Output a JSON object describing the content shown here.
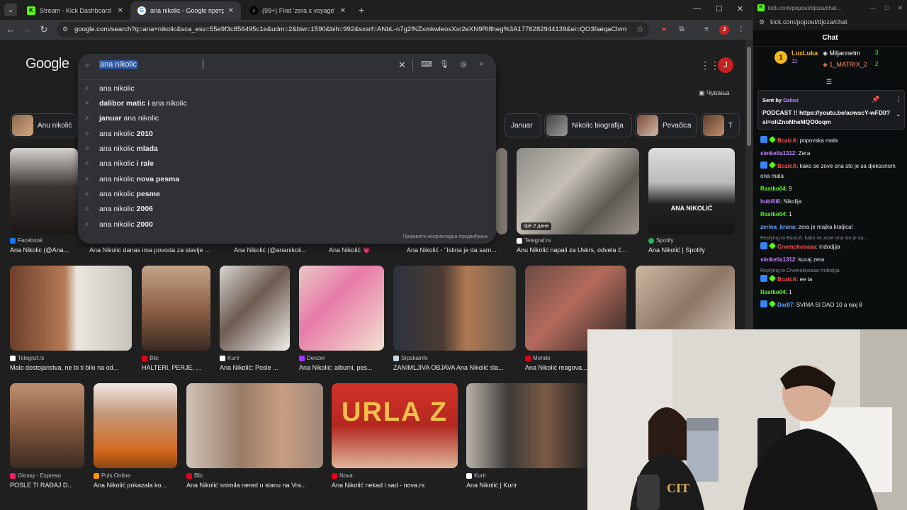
{
  "browser": {
    "tabs": [
      {
        "title": "Stream - Kick Dashboard",
        "favicon": "kick-icon",
        "active": false
      },
      {
        "title": "ana nikolic - Google претрага",
        "favicon": "google-icon",
        "active": true
      },
      {
        "title": "(99+) Find 'zera x voyage' on Ti...",
        "favicon": "tiktok-icon",
        "active": false
      }
    ],
    "url": "google.com/search?q=ana+nikolic&sca_esv=55e9f3c856495c1e&udm=2&biw=1590&bih=992&sxsrf=ANbL-n7g2fNZxmkwleosXxr2eXN9Rl8heg%3A1776282944139&ei=QO3faeqaClvmxc8...",
    "profile_initial": "J"
  },
  "google": {
    "logo": "Google",
    "avatar_initial": "J",
    "save_label": "Чувања",
    "query": "ana nikolic",
    "suggestions": [
      {
        "prefix": "",
        "bold": "",
        "suffix": "ana nikolic"
      },
      {
        "prefix": "",
        "bold": "dalibor matic i",
        "suffix": " ana nikolic"
      },
      {
        "prefix": "",
        "bold": "januar",
        "suffix": " ana nikolic"
      },
      {
        "prefix": "ana nikolic ",
        "bold": "2010",
        "suffix": ""
      },
      {
        "prefix": "ana nikolic ",
        "bold": "mlada",
        "suffix": ""
      },
      {
        "prefix": "ana nikolic ",
        "bold": "i rale",
        "suffix": ""
      },
      {
        "prefix": "ana nikolic ",
        "bold": "nova pesma",
        "suffix": ""
      },
      {
        "prefix": "ana nikolic ",
        "bold": "pesme",
        "suffix": ""
      },
      {
        "prefix": "ana nikolic ",
        "bold": "2006",
        "suffix": ""
      },
      {
        "prefix": "ana nikolic ",
        "bold": "2000",
        "suffix": ""
      }
    ],
    "report_text": "Пријавите неприкладна предвиђања",
    "chips": [
      "Anu nikolić",
      "Januar",
      "Nikolic biografija",
      "Pevačica",
      "T"
    ],
    "images_row1": [
      {
        "source": "Facebook",
        "caption": "Ana Nikolic (@Ana..."
      },
      {
        "source": "",
        "caption": "Ana Nikolić danas ima povoda za slavlje ..."
      },
      {
        "source": "",
        "caption": "Ana Nikolić (@ananikoli..."
      },
      {
        "source": "",
        "caption": "Ana Nikolić 💗"
      },
      {
        "source": "",
        "caption": "Ana Nikolić - \"Istina je da sam..."
      },
      {
        "source": "Telegraf.rs",
        "caption": "Anu Nikolić napali za Uskrs, odvela č...",
        "badge": "пре 2 дана"
      },
      {
        "source": "Spotify",
        "caption": "Ana Nikolić | Spotify",
        "overlay": "ANA NIKOLIĆ"
      }
    ],
    "images_row2": [
      {
        "source": "Telegraf.rs",
        "caption": "Malo dostojanstva, ne bi ti bilo na od..."
      },
      {
        "source": "Blic",
        "caption": "HALTERI, PERJE, ..."
      },
      {
        "source": "Kurir",
        "caption": "Ana Nikolić: Posle ..."
      },
      {
        "source": "Deezer",
        "caption": "Ana Nikolić: albumi, pes..."
      },
      {
        "source": "Srpskainfo",
        "caption": "ZANIMLJIVA OBJAVA Ana Nikolić sla..."
      },
      {
        "source": "Mondo",
        "caption": "Ana Nikolić reagova..."
      }
    ],
    "images_row3": [
      {
        "source": "Glossy - Espreso",
        "caption": "POSLE TI RAĐAJ D..."
      },
      {
        "source": "Puls Online",
        "caption": "Ana Nikolić pokazala ko..."
      },
      {
        "source": "Blic",
        "caption": "Ana Nikolić snimila nered u stanu na Vra..."
      },
      {
        "source": "Nova",
        "caption": "Ana Nikolić nekad i sad - nova.rs",
        "overlay": "URLA Z"
      },
      {
        "source": "Kurir",
        "caption": "Ana Nikolić | Kurir"
      }
    ]
  },
  "chat": {
    "window_title": "kick.com/popout/djoza/chat...",
    "url": "kick.com/popout/djoza/chat",
    "header": "Chat",
    "leaderboard": {
      "first": {
        "name": "LuxLuka",
        "count": "11"
      },
      "second": {
        "name": "Miljannetm",
        "count": "3"
      },
      "third": {
        "name": "1_MATRIX_2",
        "count": "2"
      },
      "rank": "1"
    },
    "pinned": {
      "sent_by_label": "Sent by",
      "user": "Dziksi",
      "body": "PODCAST !! https://youtu.be/aowscY-wFD0?si=oliZnoNheMQO0oqm"
    },
    "messages": [
      {
        "user": "BozicA",
        "color": "#ff4d4d",
        "badges": true,
        "text": "popovska mala"
      },
      {
        "user": "simkella1312",
        "color": "#c084fc",
        "badges": false,
        "text": "Zera"
      },
      {
        "user": "BozicA",
        "color": "#ff4d4d",
        "badges": true,
        "text": "kako se zove ona sto je sa djeksonom ona mala"
      },
      {
        "user": "Rastko04",
        "color": "#53fc18",
        "badges": false,
        "text": "9"
      },
      {
        "user": "bubilii6",
        "color": "#c084fc",
        "badges": false,
        "text": "Nikolija"
      },
      {
        "user": "Rastko04",
        "color": "#53fc18",
        "badges": false,
        "text": "1"
      },
      {
        "user": "zerina_kruna",
        "color": "#60a5fa",
        "badges": false,
        "text": "zera je majka kraljica!"
      },
      {
        "reply": "Replying to BozicA: kako se zove ona sto je sa...",
        "user": "Crvenokosaaa",
        "color": "#ff4d4d",
        "badges": true,
        "text": "indodjija"
      },
      {
        "user": "simkella1312",
        "color": "#c084fc",
        "badges": false,
        "text": "kucaj zera"
      },
      {
        "reply": "Replying to Crvenokosaaa: indodjija",
        "user": "BozicA",
        "color": "#ff4d4d",
        "badges": true,
        "text": "ee ta"
      },
      {
        "user": "Rastko04",
        "color": "#53fc18",
        "badges": false,
        "text": "1"
      },
      {
        "user": "Dar87",
        "color": "#60a5fa",
        "badges": true,
        "text": "SVIMA SI DAO 10 a njoj 8"
      }
    ]
  }
}
